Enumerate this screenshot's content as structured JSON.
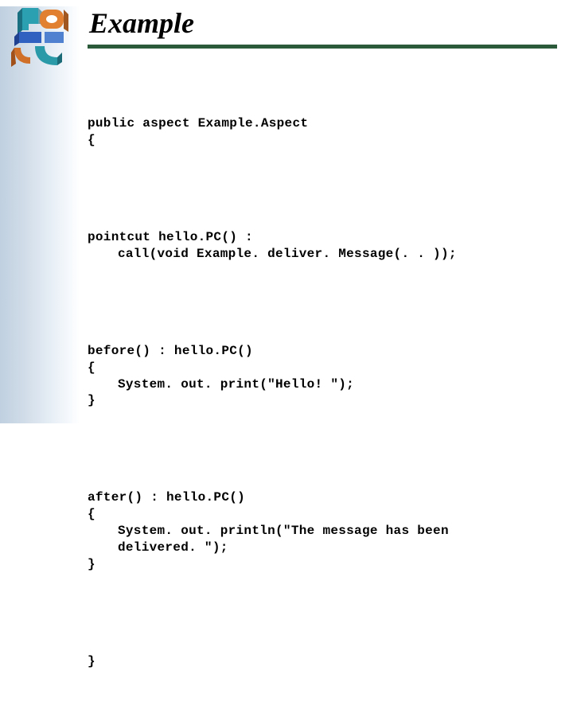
{
  "title": "Example",
  "code": {
    "decl1": "public aspect Example.Aspect",
    "decl2": "{",
    "pointcut1": "pointcut hello.PC() :",
    "pointcut2": "call(void Example. deliver. Message(. . ));",
    "before1": "before() : hello.PC()",
    "before2": "{",
    "before3": "System. out. print(\"Hello! \");",
    "before4": "}",
    "after1": "after() : hello.PC()",
    "after2": "{",
    "after3": "System. out. println(\"The message has been",
    "after3b": "delivered. \");",
    "after4": "}",
    "close": "}"
  }
}
